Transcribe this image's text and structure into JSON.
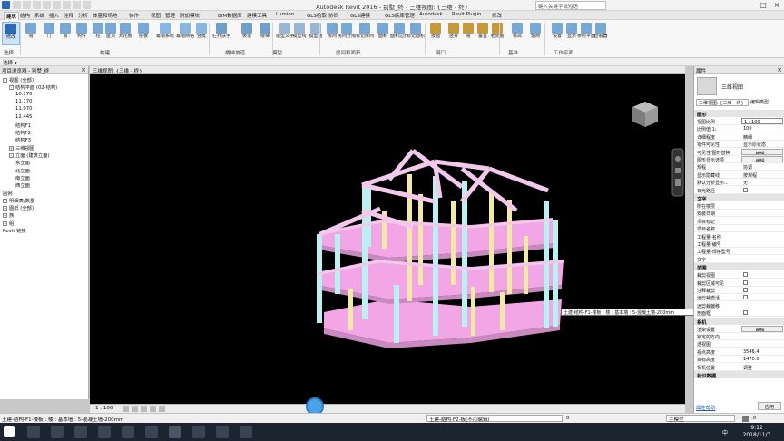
{
  "window": {
    "title": "Autodesk Revit 2016 -    别墅_终 - 三维视图: {三维 - 终}",
    "search_placeholder": "键入关键字或短语"
  },
  "tabs": [
    "建筑",
    "结构",
    "系统",
    "插入",
    "注释",
    "分析",
    "体量和场地",
    "协作",
    "视图",
    "管理",
    "附加模块",
    "BIM数据库",
    "建模工具",
    "Lumion",
    "GLS拾取",
    "协同",
    "GLS建模",
    "GLS族库管理",
    "Autodesk",
    "Revit Plugin",
    "修改"
  ],
  "ribbon": {
    "buttons": [
      "修改",
      "墙",
      "门",
      "窗",
      "构件",
      "柱",
      "屋顶",
      "天花板",
      "楼板",
      "幕墙系统",
      "幕墙网格",
      "竖梃",
      "栏杆扶手",
      "坡道",
      "楼梯",
      "模型文字",
      "模型线",
      "模型组",
      "房间",
      "房间分隔",
      "标记房间",
      "面积",
      "面积边界",
      "标记面积",
      "按面",
      "竖井",
      "墙",
      "垂直",
      "老虎窗",
      "标高",
      "轴网",
      "设置",
      "显示",
      "参照平面",
      "查看器"
    ],
    "groups": [
      "选择",
      "构建",
      "楼梯坡道",
      "模型",
      "房间和面积",
      "洞口",
      "基准",
      "工作平面"
    ],
    "select_label": "选择 ▾"
  },
  "project_browser": {
    "title": "项目浏览器 - 别墅_终",
    "items": [
      {
        "label": "视图 (全部)",
        "level": 0,
        "toggle": "-"
      },
      {
        "label": "结构平面 (02-结构)",
        "level": 1,
        "toggle": "-"
      },
      {
        "label": "10.170",
        "level": 2,
        "toggle": ""
      },
      {
        "label": "11.170",
        "level": 2,
        "toggle": ""
      },
      {
        "label": "11.970",
        "level": 2,
        "toggle": ""
      },
      {
        "label": "12.445",
        "level": 2,
        "toggle": ""
      },
      {
        "label": "结构F1",
        "level": 2,
        "toggle": ""
      },
      {
        "label": "结构F2",
        "level": 2,
        "toggle": ""
      },
      {
        "label": "结构F3",
        "level": 2,
        "toggle": ""
      },
      {
        "label": "三维视图",
        "level": 1,
        "toggle": "+"
      },
      {
        "label": "立面 (建筑立面)",
        "level": 1,
        "toggle": "-"
      },
      {
        "label": "东立面",
        "level": 2,
        "toggle": ""
      },
      {
        "label": "北立面",
        "level": 2,
        "toggle": ""
      },
      {
        "label": "南立面",
        "level": 2,
        "toggle": ""
      },
      {
        "label": "西立面",
        "level": 2,
        "toggle": ""
      },
      {
        "label": "图例",
        "level": 0,
        "toggle": ""
      },
      {
        "label": "明细表/数量",
        "level": 0,
        "toggle": "+"
      },
      {
        "label": "图纸 (全部)",
        "level": 0,
        "toggle": "+"
      },
      {
        "label": "族",
        "level": 0,
        "toggle": "+"
      },
      {
        "label": "组",
        "level": 0,
        "toggle": "+"
      },
      {
        "label": "Revit 链接",
        "level": 0,
        "toggle": ""
      }
    ]
  },
  "view_tab": "三维视图: {三维 - 终}",
  "view_bar": {
    "scale": "1 : 100"
  },
  "tooltip": "土建-结构-F1-楼板 : 楼 : 基本墙 : 5-混凝土墙-200mm",
  "properties": {
    "title": "属性",
    "type_name": "三维视图",
    "instance_selector": "三维视图: {三维 - 终}",
    "edit_type": "编辑类型",
    "categories": [
      {
        "name": "图形",
        "rows": [
          {
            "k": "视图比例",
            "v": "1 : 100",
            "kind": "field"
          },
          {
            "k": "比例值 1:",
            "v": "100",
            "kind": "text"
          },
          {
            "k": "详细程度",
            "v": "精细",
            "kind": "text"
          },
          {
            "k": "零件可见性",
            "v": "显示原状态",
            "kind": "text"
          },
          {
            "k": "可见性/图形替换",
            "v": "编辑...",
            "kind": "button"
          },
          {
            "k": "图形显示选项",
            "v": "编辑...",
            "kind": "button"
          },
          {
            "k": "规程",
            "v": "协调",
            "kind": "text"
          },
          {
            "k": "显示隐藏线",
            "v": "按规程",
            "kind": "text"
          },
          {
            "k": "默认分析显示...",
            "v": "无",
            "kind": "text"
          },
          {
            "k": "日光路径",
            "v": "",
            "kind": "check"
          }
        ]
      },
      {
        "name": "文字",
        "rows": [
          {
            "k": "所在楼层",
            "v": "",
            "kind": "text"
          },
          {
            "k": "安装日期",
            "v": "",
            "kind": "text"
          },
          {
            "k": "项目标记",
            "v": "",
            "kind": "text"
          },
          {
            "k": "项目名称",
            "v": "",
            "kind": "text"
          },
          {
            "k": "工程量-名称",
            "v": "",
            "kind": "text"
          },
          {
            "k": "工程量-编号",
            "v": "",
            "kind": "text"
          },
          {
            "k": "工程量-规格型号",
            "v": "",
            "kind": "text"
          },
          {
            "k": "文字",
            "v": "",
            "kind": "text"
          }
        ]
      },
      {
        "name": "范围",
        "rows": [
          {
            "k": "裁剪视图",
            "v": "",
            "kind": "check"
          },
          {
            "k": "裁剪区域可见",
            "v": "",
            "kind": "check"
          },
          {
            "k": "注释裁剪",
            "v": "",
            "kind": "check"
          },
          {
            "k": "远剪裁激活",
            "v": "",
            "kind": "check"
          },
          {
            "k": "远剪裁偏移",
            "v": "",
            "kind": "text"
          },
          {
            "k": "剖面框",
            "v": "",
            "kind": "check"
          }
        ]
      },
      {
        "name": "相机",
        "rows": [
          {
            "k": "渲染设置",
            "v": "编辑...",
            "kind": "button"
          },
          {
            "k": "锁定的方向",
            "v": "",
            "kind": "text"
          },
          {
            "k": "透视图",
            "v": "",
            "kind": "text"
          },
          {
            "k": "视点高度",
            "v": "3546.4",
            "kind": "text"
          },
          {
            "k": "目标高度",
            "v": "1470.0",
            "kind": "text"
          },
          {
            "k": "相机位置",
            "v": "调整",
            "kind": "text"
          }
        ]
      },
      {
        "name": "标识数据",
        "rows": []
      }
    ],
    "help_link": "属性帮助",
    "apply": "应用"
  },
  "statusbar": {
    "left": "土建-结构-F1-楼板 : 楼 : 基本墙 : 5-混凝土墙-200mm",
    "center": "土建-结构-F2-板(不可编辑)",
    "workset_value": "0",
    "design_option": "主模型",
    "filter": ":0"
  },
  "taskbar": {
    "time": "9:12",
    "date": "2018/11/7",
    "ime": "中"
  },
  "colors": {
    "slab": "#f3a6e6",
    "column": "#f2e8a8",
    "wall": "#b9f0f2",
    "beam": "#f2c9ea",
    "canvas": "#000000"
  }
}
